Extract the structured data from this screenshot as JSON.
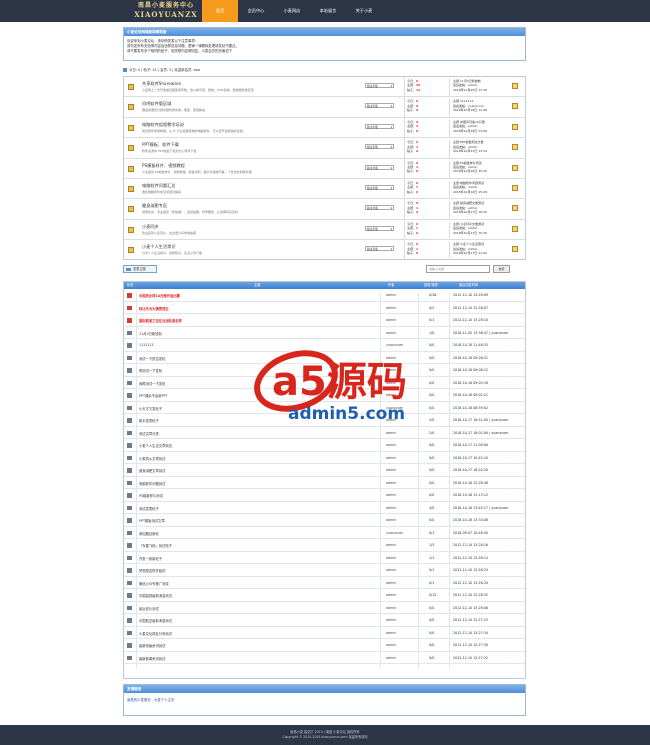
{
  "header": {
    "logo_cn": "南昌小麦服务中心",
    "logo_en": "XIAOYUANZX",
    "nav": [
      "首页",
      "会员中心",
      "小麦网店",
      "本站留言",
      "关于小麦"
    ]
  },
  "notice": {
    "title": "小麦论坛网络新闻帮助版",
    "lines": [
      "欢迎来到小麦论坛，请尽情发表以下注意事项：",
      "请勿发布有关色情内容及违禁信息问题，遵律一律删除处理请发帖不要过。",
      "请不要发布多个相同的贴子，相关联内容情回复，小麦会员的页面如下"
    ]
  },
  "stats": "今日: 0 | 帖子: 41 | 会员: 2 | 欢迎新会员: aaa",
  "moderator_label": "版主列表",
  "forums": [
    {
      "name": "共享软件Shareware",
      "desc": "小麦网上二次开发类基础使用年数，含以前可用，微信，CMS系统，微信服务类应用",
      "today": "0",
      "topics": "28",
      "posts": "12",
      "last_title": "主题:11月5日新放制",
      "last_user": "admin",
      "last_time": "2018年11月25日 13:36"
    },
    {
      "name": "问吧软件版区域",
      "desc": "理发者服务分销问题找软件类，能答，使用解决",
      "today": "0",
      "topics": "0",
      "posts": "0",
      "last_title": "主题:1111111",
      "last_user": "yuanxcom",
      "last_time": "2018年10月18日 11:48"
    },
    {
      "name": "电脑软件组程教学培训",
      "desc": "常见软件使用教程，从 IT 行业发展延伸的电脑软件，可以去开发微信的系统。",
      "today": "0",
      "topics": "3",
      "posts": "0",
      "last_title": "主题:中国养月案10只量",
      "last_user": "admin",
      "last_time": "2018年10月18日 13:06"
    },
    {
      "name": "PPT模板、软件下载",
      "desc": "软件资源中 PPT模板下载及办公软件下载",
      "today": "0",
      "topics": "1",
      "posts": "0",
      "last_title": "主题:PPT模板测试文章",
      "last_user": "admin",
      "last_time": "2018年10月21日 13:34"
    },
    {
      "name": "PS模板样片、视频教程",
      "desc": "小麦提供 PS模板样片、视频教程、模板资料、图片处理技巧等，个性化的调整处理",
      "today": "0",
      "topics": "1",
      "posts": "0",
      "last_title": "主题:PS模板样片测试",
      "last_user": "admin",
      "last_time": "2018年10月16日 15:29"
    },
    {
      "name": "电脑软件问题汇总",
      "desc": "收集电脑软件常见问题及解答",
      "today": "0",
      "topics": "1",
      "posts": "0",
      "last_title": "主题:电脑软件问题测试",
      "last_user": "admin",
      "last_time": "2018年10月16日 15:28"
    },
    {
      "name": "健身减肥专区",
      "desc": "健康饮食、专业健身（含瑜伽），运动提醒、科学塑形，让你拥有好身材",
      "today": "0",
      "topics": "1",
      "posts": "0",
      "last_title": "主题:健身减肥文章测试",
      "last_user": "admin",
      "last_time": "2018年10月17日 16:20"
    },
    {
      "name": "小麦同乡",
      "desc": "欢迎来到小麦同乡，在这里分享你的故事",
      "today": "0",
      "topics": "1",
      "posts": "0",
      "last_title": "主题:小麦同乡文章测试",
      "last_user": "admin",
      "last_time": "2018年10月17日 10:45"
    },
    {
      "name": "小麦个人生活常识",
      "desc": "分享个人生活常识、健康知识、生活小窍门等",
      "today": "0",
      "topics": "1",
      "posts": "0",
      "last_title": "主题:小麦个人生活测试",
      "last_user": "admin",
      "last_time": "2018年10月17日 11:00"
    }
  ],
  "tools": {
    "new_topic": "发表主题",
    "search_placeholder": "请输入关键",
    "search_button": "搜索"
  },
  "thread_headers": [
    "状态",
    "主题",
    "作者",
    "回复/查看",
    "最后回复时间"
  ],
  "threads": [
    {
      "title": "中国男女排14日晚开始比赛",
      "author": "admin",
      "reply": "0/26",
      "time": "2012-12-10 15:28:09",
      "top": true
    },
    {
      "title": "科比牛为大满贯而生",
      "author": "admin",
      "reply": "0/2",
      "time": "2012-12-10 15:28:07",
      "top": true
    },
    {
      "title": "国际影星三位在日战队报名表",
      "author": "admin",
      "reply": "0/1",
      "time": "2012-12-10 15:28:10",
      "top": true
    },
    {
      "title": "11月5日新放制",
      "author": "admin",
      "reply": "1/0",
      "time": "2018-11-05 13:36:47 | yuanxcom",
      "top": false
    },
    {
      "title": "1111111",
      "author": "yuanxcom",
      "reply": "0/0",
      "time": "2018-10-18 11:48:33",
      "top": false
    },
    {
      "title": "测试一下是否发帖",
      "author": "admin",
      "reply": "0/0",
      "time": "2018-10-18 09:26:21",
      "top": false
    },
    {
      "title": "再测试一下发帖",
      "author": "admin",
      "reply": "0/0",
      "time": "2018-10-18 09:08:12",
      "top": false
    },
    {
      "title": "我再测试一下发帖",
      "author": "admin",
      "reply": "0/0",
      "time": "2018-10-18 09:03:18",
      "top": false
    },
    {
      "title": "PPT课余不会用PPT",
      "author": "admin",
      "reply": "0/0",
      "time": "2018-10-18 09:02:21",
      "top": false
    },
    {
      "title": "小天才又发帖子",
      "author": "yuanxcom",
      "reply": "0/0",
      "time": "2018-10-16 08:59:02",
      "top": false
    },
    {
      "title": "新手发表帖子",
      "author": "admin",
      "reply": "5/0",
      "time": "2018-10-17 16:51:00 | yuanxcom",
      "top": false
    },
    {
      "title": "测试文章分类",
      "author": "admin",
      "reply": "2/0",
      "time": "2018-10-17 16:01:00 | yuanxcom",
      "top": false
    },
    {
      "title": "小麦个人生活文章测试",
      "author": "admin",
      "reply": "0/0",
      "time": "2018-10-17 11:00:00",
      "top": false
    },
    {
      "title": "小麦同乡文章测试",
      "author": "admin",
      "reply": "0/0",
      "time": "2018-10-17 10:45:10",
      "top": false
    },
    {
      "title": "健身减肥文章测试",
      "author": "admin",
      "reply": "0/0",
      "time": "2018-10-17 16:20:20",
      "top": false
    },
    {
      "title": "电脑软件问题测试",
      "author": "admin",
      "reply": "0/0",
      "time": "2018-10-16 15:28:48",
      "top": false
    },
    {
      "title": "PS模板样片测试",
      "author": "admin",
      "reply": "0/0",
      "time": "2018-10-16 15:13:12",
      "top": false
    },
    {
      "title": "测试发表帖子",
      "author": "admin",
      "reply": "4/0",
      "time": "2018-10-16 13:45:17 | yuanxcom",
      "top": false
    },
    {
      "title": "PPT模板测试文章",
      "author": "admin",
      "reply": "0/0",
      "time": "2018-10-18 13:34:08",
      "top": false
    },
    {
      "title": "添加题目新帖",
      "author": "yuanxcom",
      "reply": "0/1",
      "time": "2018-09-07 10:48:50",
      "top": false
    },
    {
      "title": "「青春飞扬」测试帖子",
      "author": "admin",
      "reply": "1/5",
      "time": "2012-12-10 15:28:16",
      "top": false
    },
    {
      "title": "开发一篇新帖子",
      "author": "admin",
      "reply": "1/1",
      "time": "2012-12-10 15:28:14",
      "top": false
    },
    {
      "title": "梦想是这样开始的",
      "author": "admin",
      "reply": "0/1",
      "time": "2012-12-10 15:28:24",
      "top": false
    },
    {
      "title": "微信公众号推广测试",
      "author": "admin",
      "reply": "0/1",
      "time": "2012-12-10 15:28:20",
      "top": false
    },
    {
      "title": "中国高铁最新消息测试",
      "author": "admin",
      "reply": "0/12",
      "time": "2012-12-10 15:28:32",
      "top": false
    },
    {
      "title": "最近影片测试",
      "author": "admin",
      "reply": "0/0",
      "time": "2012-12-10 15:28:06",
      "top": false
    },
    {
      "title": "中国航空最新消息测试",
      "author": "admin",
      "reply": "0/0",
      "time": "2012-12-10 15:27:25",
      "top": false
    },
    {
      "title": "小麦论坛网友分享测试",
      "author": "admin",
      "reply": "0/0",
      "time": "2012-12-10 15:27:34",
      "top": false
    },
    {
      "title": "最新改版资讯测试",
      "author": "admin",
      "reply": "0/0",
      "time": "2012-12-10 15:27:30",
      "top": false
    },
    {
      "title": "最新新闻资讯测试",
      "author": "admin",
      "reply": "0/0",
      "time": "2012-12-10 15:27:22",
      "top": false
    }
  ],
  "links": {
    "title": "友情链接",
    "items": [
      "南昌的小麦服务",
      "大麦个人主页"
    ]
  },
  "footer": {
    "line1": "南昌小麦 建站于 2010 | 南昌 小麦论坛 版权所有",
    "line2": "Copyright © 2010-2018 xiaoyuanzx.com 保留所有权利"
  },
  "watermark": {
    "brand": "a5源码",
    "url": "admin5.com",
    "colors": {
      "red": "#d9261c",
      "blue": "#1f5fb0"
    }
  }
}
